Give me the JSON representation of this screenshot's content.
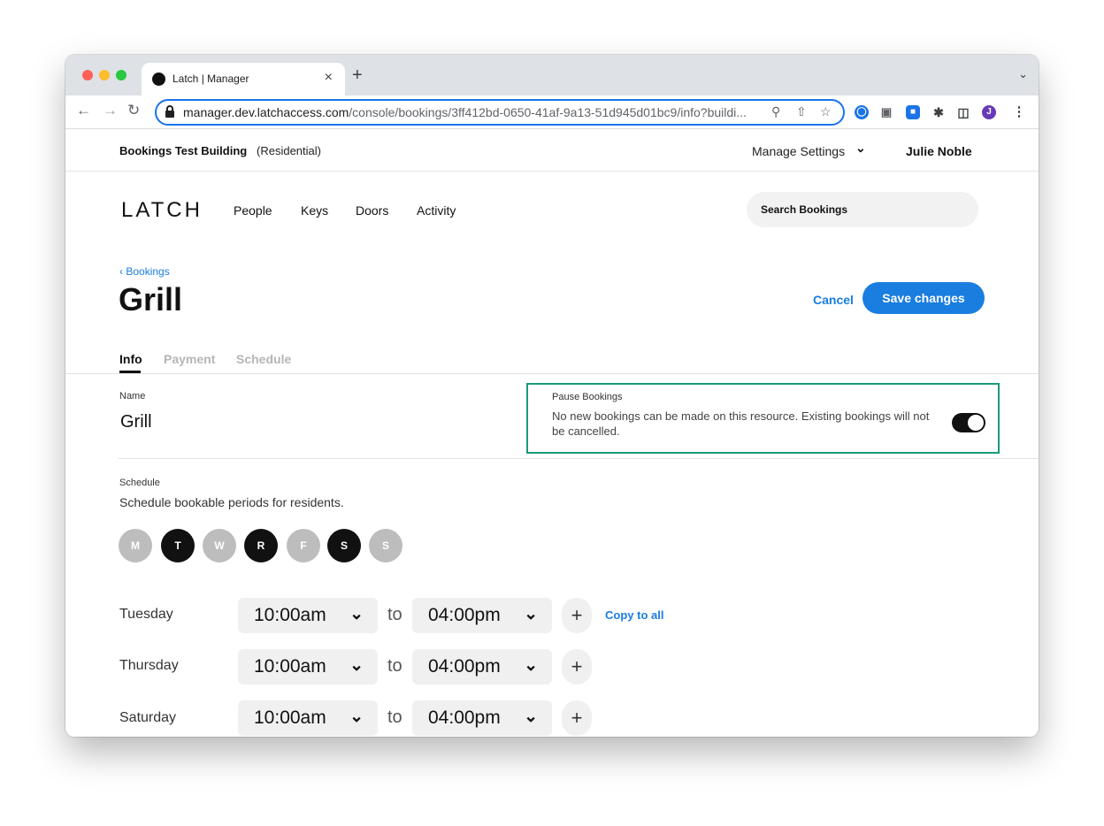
{
  "browser": {
    "tab_title": "Latch | Manager",
    "tab_close": "×",
    "new_tab": "+",
    "url_host": "manager.dev.latchaccess.com",
    "url_path": "/console/bookings/3ff412bd-0650-41af-9a13-51d945d01bc9/info?buildi...",
    "profile_initial": "J"
  },
  "topbar": {
    "building_name": "Bookings Test Building",
    "building_type": "(Residential)",
    "manage_settings": "Manage Settings",
    "user_name": "Julie Noble"
  },
  "nav": {
    "logo": "LATCH",
    "items": [
      "People",
      "Keys",
      "Doors",
      "Activity"
    ],
    "search_placeholder": "Search Bookings"
  },
  "page": {
    "back_link": "Bookings",
    "title": "Grill",
    "cancel_label": "Cancel",
    "save_label": "Save changes",
    "tabs": [
      "Info",
      "Payment",
      "Schedule"
    ],
    "active_tab": "Info"
  },
  "form": {
    "name_label": "Name",
    "name_value": "Grill",
    "pause": {
      "label": "Pause Bookings",
      "description": "No new bookings can be made on this resource. Existing bookings will not be cancelled.",
      "enabled": true
    },
    "schedule_label": "Schedule",
    "schedule_description": "Schedule bookable periods for residents.",
    "days": [
      {
        "letter": "M",
        "active": false
      },
      {
        "letter": "T",
        "active": true
      },
      {
        "letter": "W",
        "active": false
      },
      {
        "letter": "R",
        "active": true
      },
      {
        "letter": "F",
        "active": false
      },
      {
        "letter": "S",
        "active": true
      },
      {
        "letter": "S",
        "active": false
      }
    ],
    "to_word": "to",
    "copy_to_all": "Copy to all",
    "rows": [
      {
        "day": "Tuesday",
        "start": "10:00am",
        "end": "04:00pm"
      },
      {
        "day": "Thursday",
        "start": "10:00am",
        "end": "04:00pm"
      },
      {
        "day": "Saturday",
        "start": "10:00am",
        "end": "04:00pm"
      }
    ]
  },
  "colors": {
    "accent": "#1a7de0",
    "highlight_border": "#1a9b7c",
    "day_active": "#111111",
    "day_inactive": "#bdbdbd"
  }
}
